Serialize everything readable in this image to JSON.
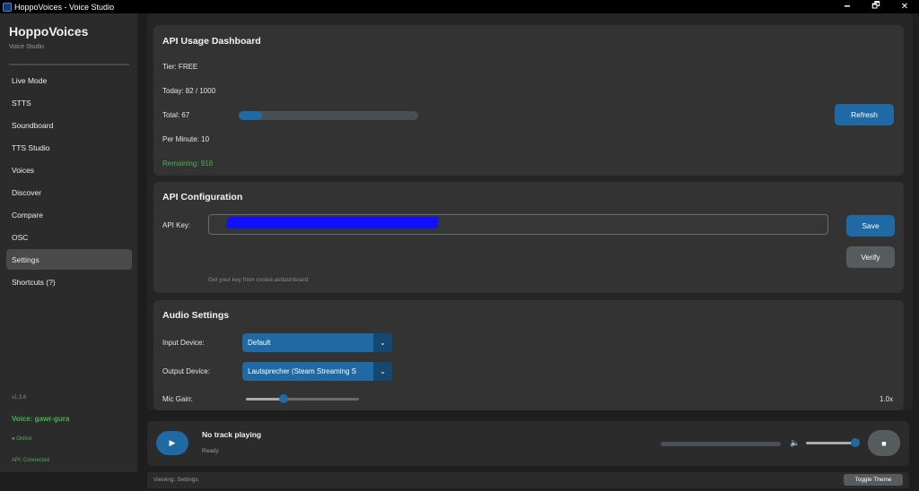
{
  "window": {
    "title": "HoppoVoices - Voice Studio",
    "controls": [
      "🗕",
      "🗗",
      "✕"
    ]
  },
  "sidebar": {
    "brand": "HoppoVoices",
    "subtitle": "Voice Studio",
    "items": [
      {
        "label": "Live Mode"
      },
      {
        "label": "STTS"
      },
      {
        "label": "Soundboard"
      },
      {
        "label": "TTS Studio"
      },
      {
        "label": "Voices"
      },
      {
        "label": "Discover"
      },
      {
        "label": "Compare"
      },
      {
        "label": "OSC"
      },
      {
        "label": "Settings",
        "active": true
      },
      {
        "label": "Shortcuts (?)"
      }
    ],
    "version": "v1.3.6",
    "voice": "Voice: gawr-gura",
    "online": "● Online",
    "api_status": "API: Connected"
  },
  "usage": {
    "title": "API Usage Dashboard",
    "tier": "Tier: FREE",
    "today": "Today: 82 / 1000",
    "total": "Total: 67",
    "total_progress": 0.13,
    "per_minute": "Per Minute: 10",
    "remaining": "Remaining: 918",
    "refresh_label": "Refresh"
  },
  "config": {
    "title": "API Configuration",
    "api_key_label": "API Key:",
    "save_label": "Save",
    "verify_label": "Verify",
    "hint": "Get your key from cvoice.ai/dashboard"
  },
  "audio": {
    "title": "Audio Settings",
    "input_label": "Input Device:",
    "input_value": "Default",
    "output_label": "Output Device:",
    "output_value": "Lautsprecher (Steam Streaming S",
    "mic_label": "Mic Gain:",
    "mic_value": "1.0x",
    "mic_level": 0.33
  },
  "player": {
    "play_icon": "▶",
    "track": "No track playing",
    "status": "Ready",
    "volume_icon": "🔈",
    "volume_level": 0.95,
    "stop_icon": "■"
  },
  "statusbar": {
    "text": "Viewing: Settings",
    "theme_label": "Toggle Theme"
  },
  "colors": {
    "accent": "#1f6aa5",
    "success": "#4caf50",
    "redaction": "#1010ff"
  }
}
